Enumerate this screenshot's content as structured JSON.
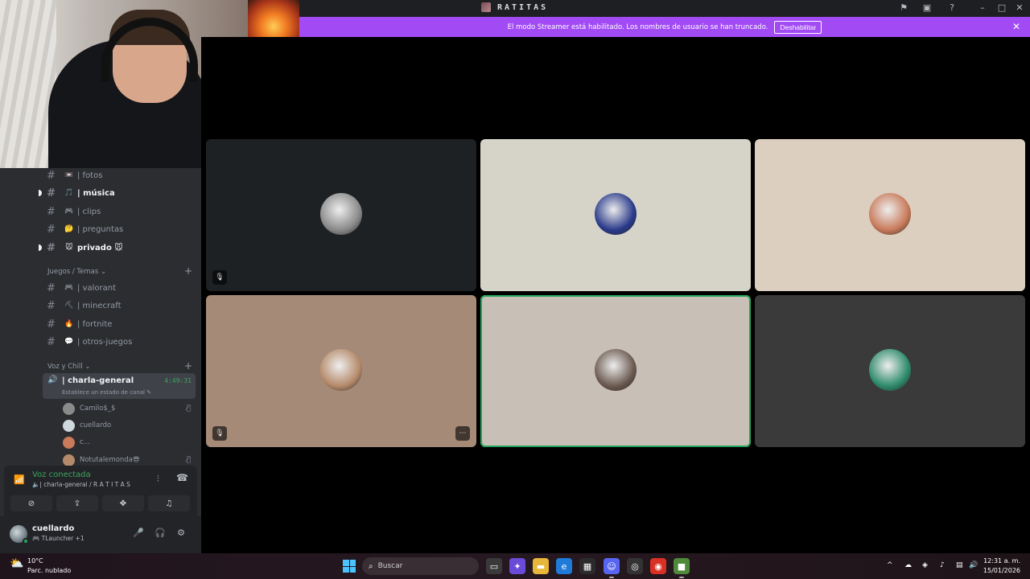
{
  "window": {
    "title": "RATITAS",
    "title_icons": [
      "inbox-icon",
      "screen-icon",
      "help-icon"
    ],
    "window_controls": [
      "minimize-icon",
      "maximize-icon",
      "close-icon"
    ]
  },
  "banner": {
    "text": "El modo Streamer está habilitado. Los nombres de usuario se han truncado.",
    "button_label": "Deshabilitar",
    "color": "#a24bf5"
  },
  "sidebar": {
    "channels_top": [
      {
        "emoji": "📼",
        "name": "| fotos",
        "unread": false
      },
      {
        "emoji": "🎵",
        "name": "| música",
        "unread": true
      },
      {
        "emoji": "🎮",
        "name": "| clips",
        "unread": false
      },
      {
        "emoji": "🤔",
        "name": "| preguntas",
        "unread": false
      },
      {
        "emoji": "🐭",
        "name": "privado 🐭",
        "unread": true
      }
    ],
    "category_games": "Juegos / Temas",
    "channels_games": [
      {
        "emoji": "🎮",
        "name": "| valorant"
      },
      {
        "emoji": "⛏",
        "name": "| minecraft"
      },
      {
        "emoji": "🔥",
        "name": "| fortnite"
      },
      {
        "emoji": "💬",
        "name": "| otros-juegos"
      }
    ],
    "category_voice": "Voz y Chill",
    "voice_channel": {
      "name": "| charla-general",
      "time": "4:49:31",
      "status": "Establece un estado de canal"
    },
    "voice_users": [
      {
        "name": "Camilo$_$",
        "muted": true
      },
      {
        "name": "cuellardo",
        "muted": false
      },
      {
        "name": "c...",
        "muted": false
      },
      {
        "name": "Notutalemonda😎",
        "muted": true
      }
    ],
    "voice_connected": {
      "title": "Voz conectada",
      "subtitle": "| charla-general / R A T I T A S"
    },
    "user": {
      "name": "cuellardo",
      "status": "TLauncher +1"
    }
  },
  "video_tiles": [
    {
      "bg": "#1e2124",
      "avatar": "#8a8a8a",
      "muted": true,
      "speaking": false,
      "more": false
    },
    {
      "bg": "#d6d4c8",
      "avatar": "#2a3a8a",
      "muted": false,
      "speaking": false,
      "more": false
    },
    {
      "bg": "#dccfbf",
      "avatar": "#c87a5a",
      "muted": false,
      "speaking": false,
      "more": false
    },
    {
      "bg": "#a58a78",
      "avatar": "#b58a6a",
      "muted": true,
      "speaking": false,
      "more": true
    },
    {
      "bg": "#c8bfb6",
      "avatar": "#6b5a50",
      "muted": false,
      "speaking": true,
      "more": false
    },
    {
      "bg": "#3a3a3a",
      "avatar": "#2e8b6b",
      "muted": false,
      "speaking": false,
      "more": false
    }
  ],
  "taskbar": {
    "weather_temp": "10°C",
    "weather_desc": "Parc. nublado",
    "search_placeholder": "Buscar",
    "time": "12:31 a. m.",
    "date": "15/01/2026"
  }
}
